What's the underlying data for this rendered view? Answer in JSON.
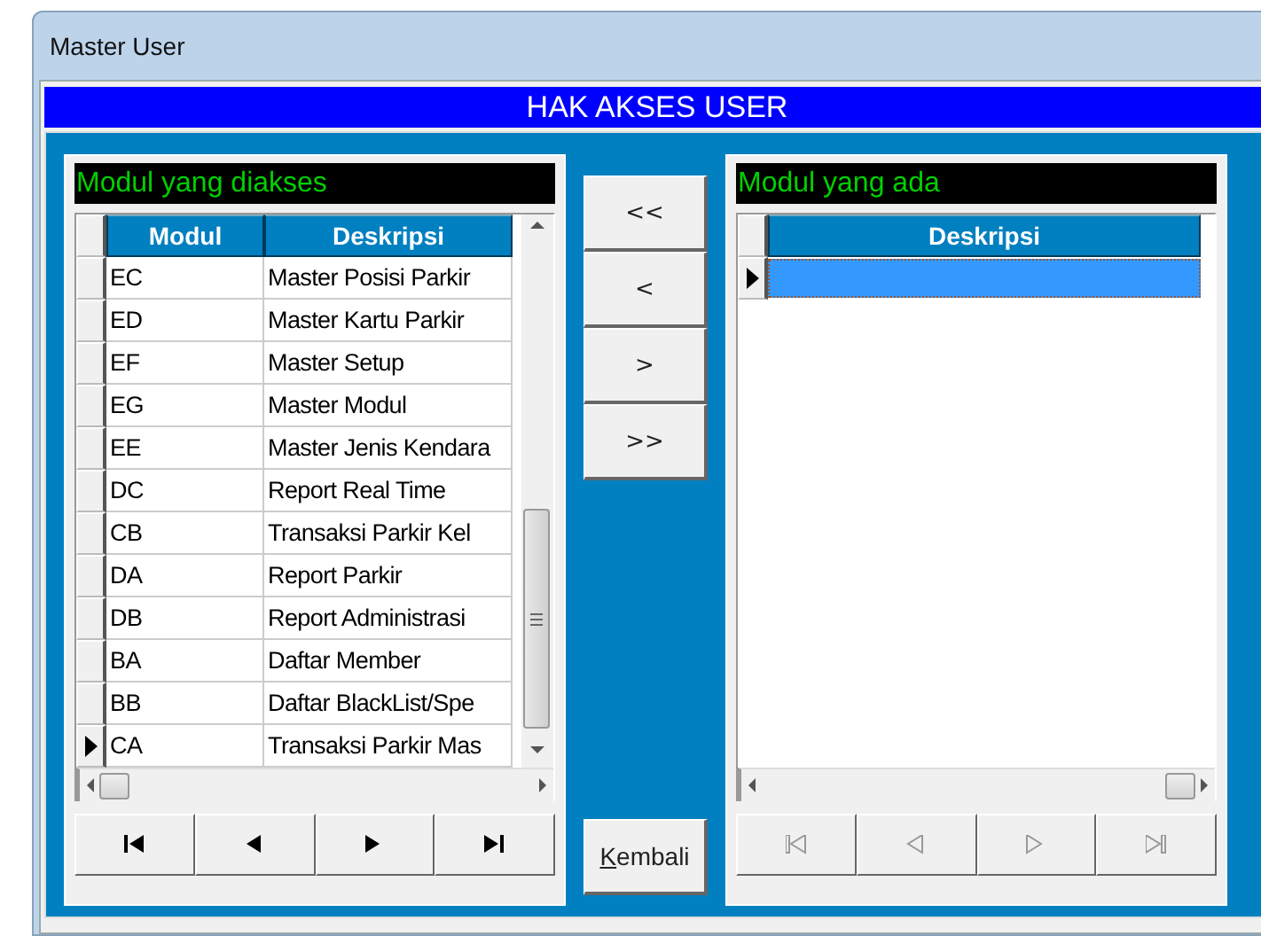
{
  "window": {
    "title": "Master User"
  },
  "header": {
    "title": "HAK AKSES USER"
  },
  "left_panel": {
    "label": "Modul yang diakses",
    "columns": [
      "Modul",
      "Deskripsi"
    ],
    "rows": [
      {
        "modul": "EC",
        "deskripsi": "Master Posisi Parkir",
        "selected": false
      },
      {
        "modul": "ED",
        "deskripsi": "Master Kartu Parkir",
        "selected": false
      },
      {
        "modul": "EF",
        "deskripsi": "Master Setup",
        "selected": false
      },
      {
        "modul": "EG",
        "deskripsi": "Master Modul",
        "selected": false
      },
      {
        "modul": "EE",
        "deskripsi": "Master Jenis Kendara",
        "selected": false
      },
      {
        "modul": "DC",
        "deskripsi": "Report Real Time",
        "selected": false
      },
      {
        "modul": "CB",
        "deskripsi": "Transaksi Parkir Kel",
        "selected": false
      },
      {
        "modul": "DA",
        "deskripsi": "Report Parkir",
        "selected": false
      },
      {
        "modul": "DB",
        "deskripsi": "Report Administrasi",
        "selected": false
      },
      {
        "modul": "BA",
        "deskripsi": "Daftar Member",
        "selected": false
      },
      {
        "modul": "BB",
        "deskripsi": "Daftar BlackList/Spe",
        "selected": false
      },
      {
        "modul": "CA",
        "deskripsi": "Transaksi Parkir Mas",
        "selected": true
      }
    ],
    "navigator": [
      {
        "kind": "first",
        "disabled": false
      },
      {
        "kind": "prev",
        "disabled": false
      },
      {
        "kind": "next",
        "disabled": false
      },
      {
        "kind": "last",
        "disabled": false
      }
    ]
  },
  "transfer_buttons": [
    {
      "label": "<<"
    },
    {
      "label": "<"
    },
    {
      "label": ">"
    },
    {
      "label": ">>"
    }
  ],
  "back_button": {
    "label": "Kembali",
    "access_key": true
  },
  "right_panel": {
    "label": "Modul yang ada",
    "columns": [
      "Deskripsi"
    ],
    "rows": [
      {
        "selected": true
      }
    ],
    "navigator": [
      {
        "kind": "first",
        "disabled": true
      },
      {
        "kind": "prev",
        "disabled": true
      },
      {
        "kind": "next",
        "disabled": true
      },
      {
        "kind": "last",
        "disabled": true
      }
    ]
  }
}
